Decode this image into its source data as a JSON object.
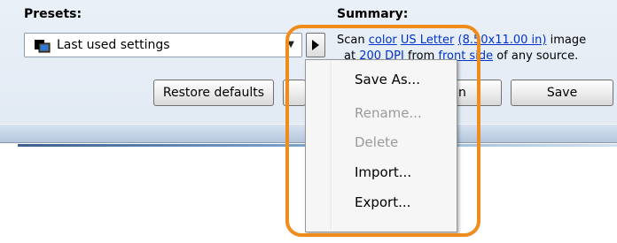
{
  "presets": {
    "heading": "Presets:",
    "selected": "Last used settings"
  },
  "summary": {
    "heading": "Summary:",
    "line1": {
      "prefix": "Scan ",
      "color": "color",
      "paper": "US Letter",
      "size": "(8.50x11.00 in)",
      "suffix": " image"
    },
    "line2": {
      "prefix": "at ",
      "dpi": "200 DPI",
      "mid": " from ",
      "side": "front side",
      "suffix": " of any source."
    }
  },
  "buttons": {
    "restore_defaults": "Restore defaults",
    "hidden_right": "n",
    "save": "Save"
  },
  "menu": {
    "items": [
      {
        "label": "Save As...",
        "enabled": true
      },
      {
        "label": "Rename...",
        "enabled": false
      },
      {
        "label": "Delete",
        "enabled": false
      },
      {
        "label": "Import...",
        "enabled": true
      },
      {
        "label": "Export...",
        "enabled": true
      }
    ]
  },
  "colors": {
    "callout": "#f08c1c",
    "link": "#0033cc",
    "dialog_bg": "#e1e9f3"
  },
  "icons": {
    "select_icon": "presets-icon",
    "dropdown": "chevron-down-icon",
    "menu_toggle": "play-arrow-icon"
  }
}
